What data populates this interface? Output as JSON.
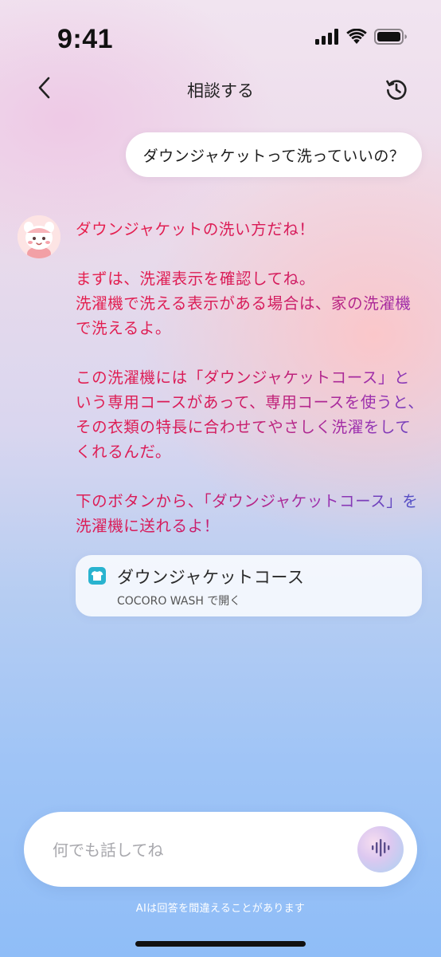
{
  "status_bar": {
    "time": "9:41",
    "icons": [
      "signal-icon",
      "wifi-icon",
      "battery-icon"
    ]
  },
  "nav": {
    "back_icon": "chevron-left-icon",
    "title": "相談する",
    "history_icon": "history-icon"
  },
  "user_message": "ダウンジャケットって洗っていいの？",
  "assistant": {
    "avatar": "assistant-avatar",
    "paragraphs": [
      "ダウンジャケットの洗い方だね！",
      "まずは、洗濯表示を確認してね。\n洗濯機で洗える表示がある場合は、家の洗濯機で洗えるよ。",
      "この洗濯機には「ダウンジャケットコース」という専用コースがあって、専用コースを使うと、その衣類の特長に合わせてやさしく洗濯をしてくれるんだ。",
      "下のボタンから、「ダウンジャケットコース」を洗濯機に送れるよ！"
    ],
    "gradient_colors": [
      "#e8204c",
      "#d61a5a",
      "#9a2fb0",
      "#2f5fd0"
    ]
  },
  "action_card": {
    "icon": "shirt-icon",
    "icon_color": "#29b3cf",
    "title": "ダウンジャケットコース",
    "subtitle": "COCORO WASH で開く"
  },
  "input": {
    "placeholder": "何でも話してね",
    "value": "",
    "voice_icon": "voice-wave-icon"
  },
  "disclaimer": "AIは回答を間違えることがあります"
}
